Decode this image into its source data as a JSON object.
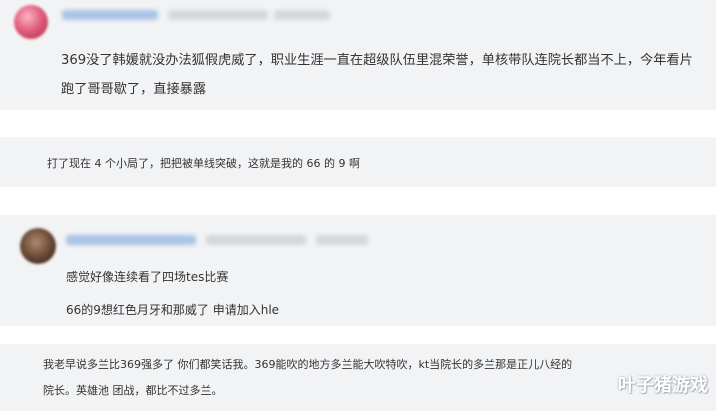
{
  "comments": [
    {
      "lines": [
        "369没了韩媛就没办法狐假虎威了，职业生涯一直在超级队伍里混荣誉，单核带队连院长都当不上，今年看片",
        "跑了哥哥歇了，直接暴露"
      ]
    },
    {
      "lines": [
        "打了现在 4 个小局了，把把被单线突破，这就是我的 66 的 9 啊"
      ]
    },
    {
      "lines": [
        "感觉好像连续看了四场tes比赛",
        "66的9想红色月牙和那威了 申请加入hle"
      ]
    },
    {
      "lines": [
        "我老早说多兰比369强多了 你们都笑话我。369能吹的地方多兰能大吹特吹，kt当院长的多兰那是正儿八经的",
        "院长。英雄池 团战，都比不过多兰。"
      ]
    }
  ],
  "watermark": "叶子猪游戏",
  "colors": {
    "card_bg": "#f2f3f5",
    "text": "#333333"
  }
}
